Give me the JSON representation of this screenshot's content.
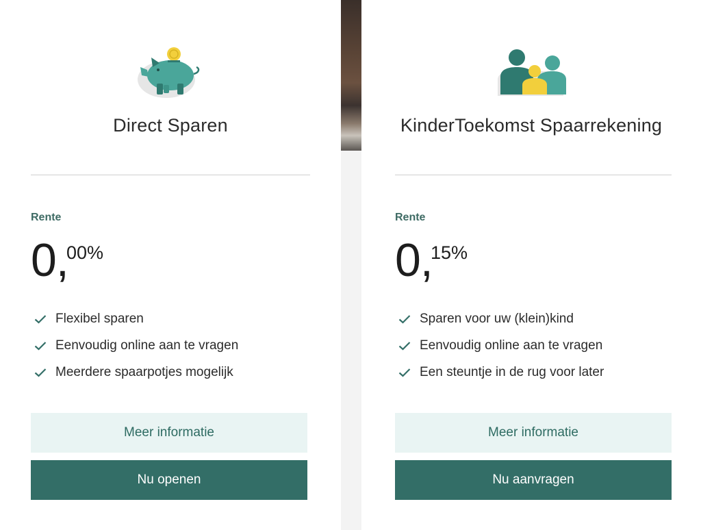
{
  "cards": [
    {
      "icon": "piggy-bank-icon",
      "title": "Direct Sparen",
      "rate_label": "Rente",
      "rate_int": "0,",
      "rate_dec": "00%",
      "features": [
        "Flexibel sparen",
        "Eenvoudig online aan te vragen",
        "Meerdere spaarpotjes mogelijk"
      ],
      "info_button": "Meer informatie",
      "primary_button": "Nu openen"
    },
    {
      "icon": "family-icon",
      "title": "KinderToekomst Spaarrekening",
      "rate_label": "Rente",
      "rate_int": "0,",
      "rate_dec": "15%",
      "features": [
        "Sparen voor uw (klein)kind",
        "Eenvoudig online aan te vragen",
        "Een steuntje in de rug voor later"
      ],
      "info_button": "Meer informatie",
      "primary_button": "Nu aanvragen"
    }
  ],
  "colors": {
    "accent": "#336e67",
    "accent_light": "#e9f4f3",
    "icon_teal": "#4aa69a",
    "icon_dark_teal": "#2f7a70",
    "icon_yellow": "#f2cf3c",
    "label": "#3e6b64"
  }
}
